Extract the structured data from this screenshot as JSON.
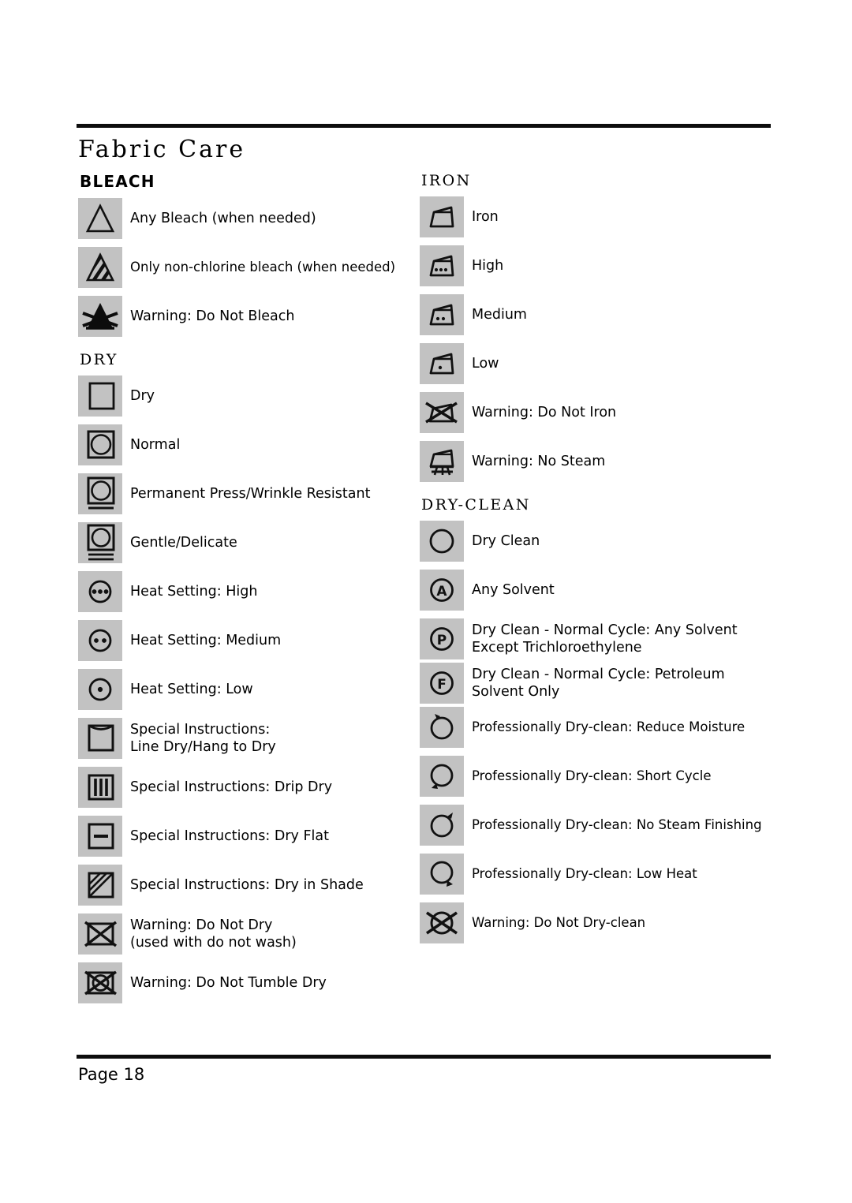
{
  "document": {
    "title": "Fabric Care",
    "page_label": "Page 18"
  },
  "sections": {
    "bleach": {
      "heading": "BLEACH",
      "items": [
        {
          "icon": "bleach-any-triangle-icon",
          "label": "Any Bleach (when needed)"
        },
        {
          "icon": "bleach-non-chlorine-striped-triangle-icon",
          "label": "Only non-chlorine bleach (when needed)"
        },
        {
          "icon": "bleach-do-not-filled-crossed-triangle-icon",
          "label": "Warning: Do Not Bleach"
        }
      ]
    },
    "dry": {
      "heading": "DRY",
      "items": [
        {
          "icon": "dry-square-icon",
          "label": "Dry"
        },
        {
          "icon": "dry-normal-square-circle-icon",
          "label": "Normal"
        },
        {
          "icon": "dry-permanent-press-icon",
          "label": "Permanent Press/Wrinkle Resistant"
        },
        {
          "icon": "dry-gentle-delicate-icon",
          "label": "Gentle/Delicate"
        },
        {
          "icon": "dry-heat-high-three-dots-icon",
          "label": "Heat Setting: High"
        },
        {
          "icon": "dry-heat-medium-two-dots-icon",
          "label": "Heat Setting: Medium"
        },
        {
          "icon": "dry-heat-low-one-dot-icon",
          "label": "Heat Setting: Low"
        },
        {
          "icon": "dry-line-dry-hang-icon",
          "label": "Special Instructions:\nLine Dry/Hang to Dry"
        },
        {
          "icon": "dry-drip-dry-icon",
          "label": "Special Instructions: Drip Dry"
        },
        {
          "icon": "dry-flat-icon",
          "label": "Special Instructions: Dry Flat"
        },
        {
          "icon": "dry-in-shade-icon",
          "label": "Special Instructions: Dry in Shade"
        },
        {
          "icon": "dry-do-not-dry-crossed-square-icon",
          "label": "Warning: Do Not Dry\n(used with do not wash)"
        },
        {
          "icon": "dry-do-not-tumble-dry-icon",
          "label": "Warning: Do Not Tumble Dry"
        }
      ]
    },
    "iron": {
      "heading": "IRON",
      "items": [
        {
          "icon": "iron-icon",
          "label": "Iron"
        },
        {
          "icon": "iron-high-three-dots-icon",
          "label": "High"
        },
        {
          "icon": "iron-medium-two-dots-icon",
          "label": "Medium"
        },
        {
          "icon": "iron-low-one-dot-icon",
          "label": "Low"
        },
        {
          "icon": "iron-do-not-iron-crossed-icon",
          "label": "Warning: Do Not Iron"
        },
        {
          "icon": "iron-no-steam-icon",
          "label": "Warning: No Steam"
        }
      ]
    },
    "dry_clean": {
      "heading": "DRY-CLEAN",
      "items": [
        {
          "icon": "dryclean-circle-icon",
          "label": "Dry Clean"
        },
        {
          "icon": "dryclean-any-solvent-a-icon",
          "label": "Any Solvent"
        },
        {
          "icon": "dryclean-p-icon",
          "label": "Dry Clean - Normal Cycle: Any Solvent\nExcept Trichloroethylene"
        },
        {
          "icon": "dryclean-f-icon",
          "label": "Dry Clean - Normal Cycle: Petroleum\nSolvent Only"
        },
        {
          "icon": "dryclean-reduce-moisture-icon",
          "label": "Professionally Dry-clean: Reduce Moisture"
        },
        {
          "icon": "dryclean-short-cycle-icon",
          "label": "Professionally Dry-clean: Short Cycle"
        },
        {
          "icon": "dryclean-no-steam-finishing-icon",
          "label": "Professionally Dry-clean: No Steam Finishing"
        },
        {
          "icon": "dryclean-low-heat-icon",
          "label": "Professionally Dry-clean: Low Heat"
        },
        {
          "icon": "dryclean-do-not-dryclean-icon",
          "label": "Warning: Do Not Dry-clean"
        }
      ]
    }
  },
  "colors": {
    "icon_background": "#c2c2c2",
    "ink": "#000000",
    "page_background": "#ffffff"
  }
}
